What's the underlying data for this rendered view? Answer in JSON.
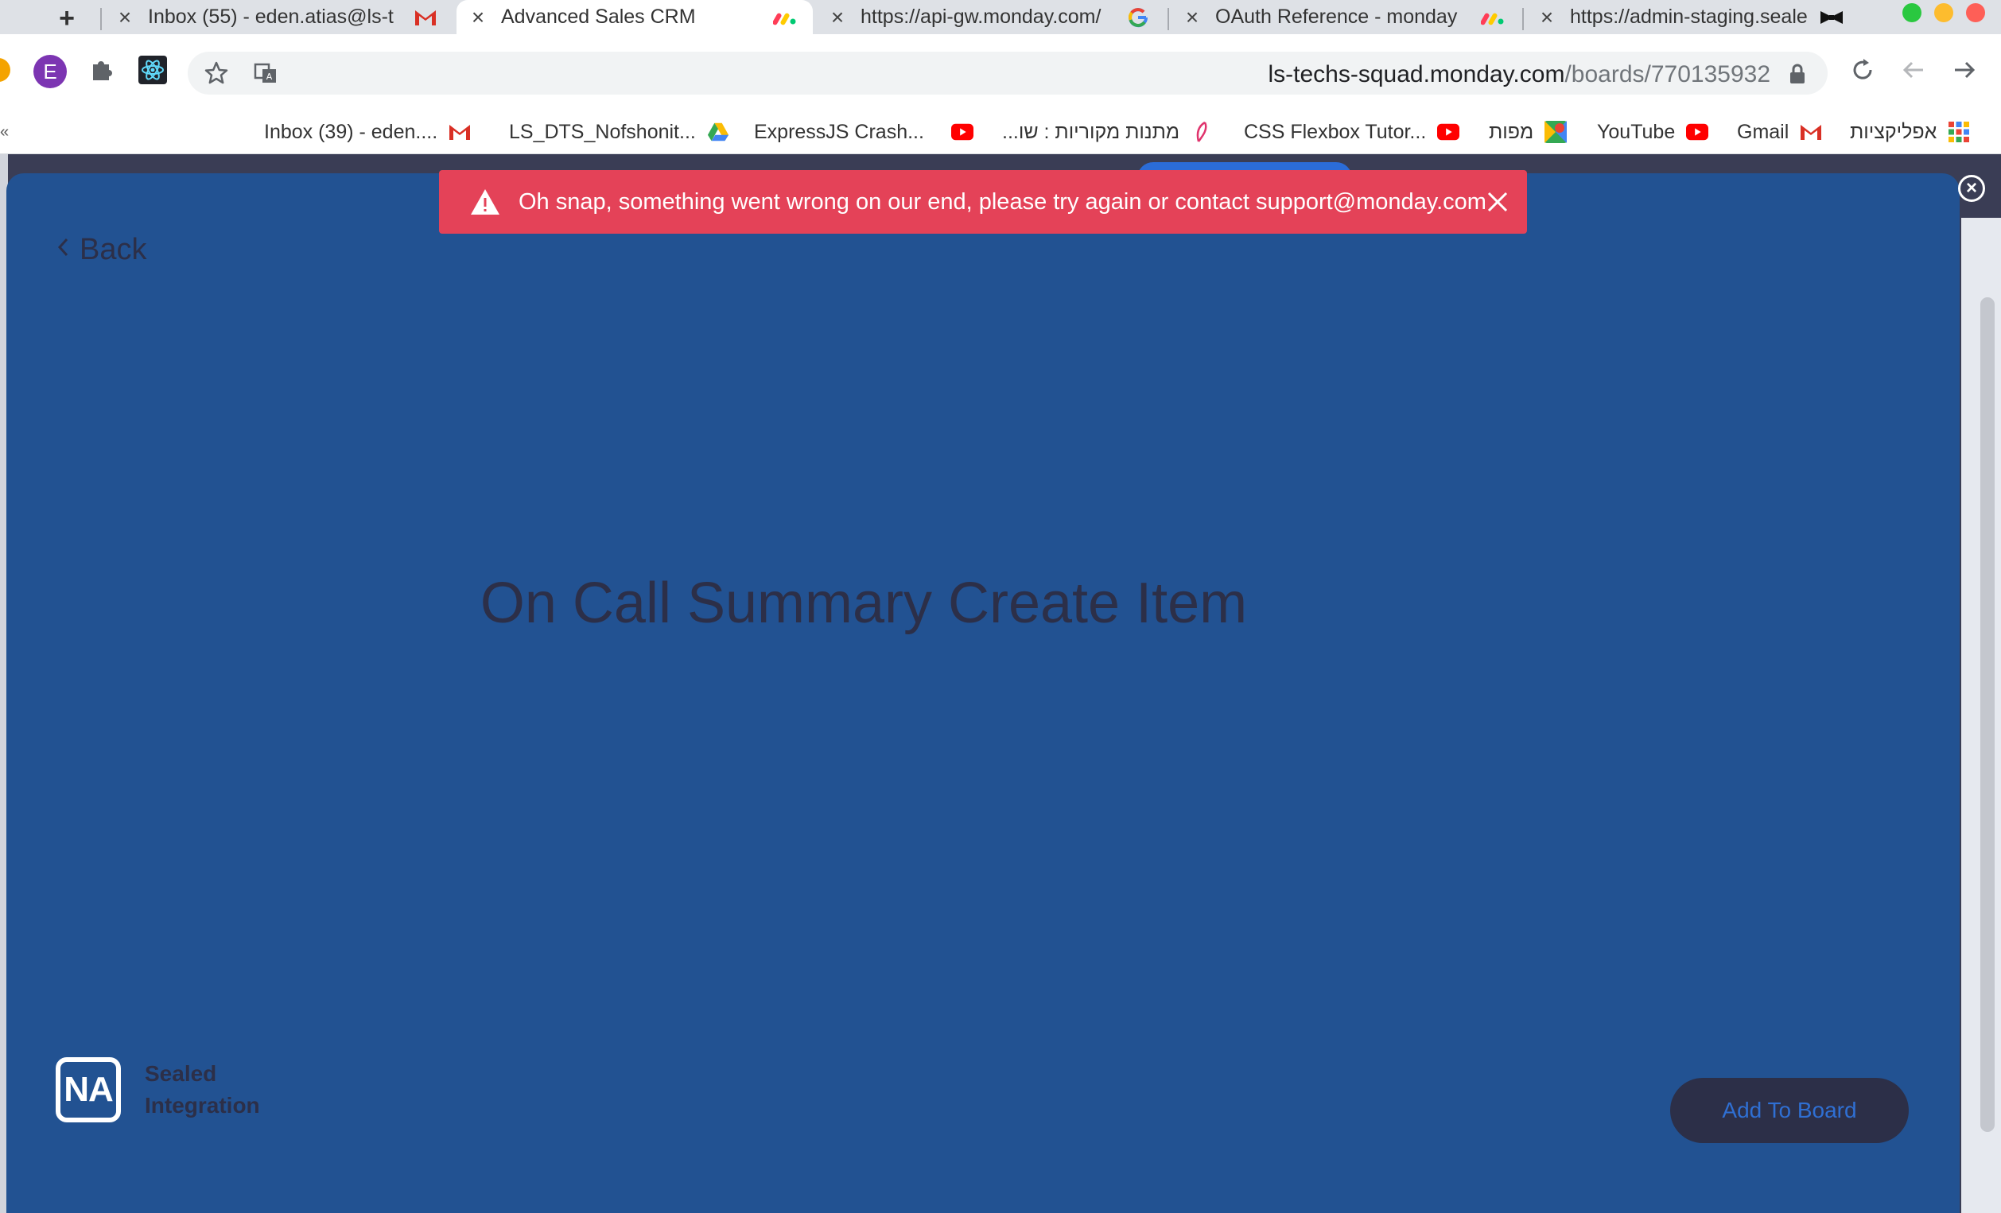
{
  "browser": {
    "new_tab_symbol": "+",
    "tabs": [
      {
        "title": "Inbox (55) - eden.atias@ls-t",
        "favicon": "gmail-icon",
        "close": "×"
      },
      {
        "title": "Advanced Sales CRM",
        "favicon": "monday-icon",
        "close": "×"
      },
      {
        "title": "https://api-gw.monday.com/",
        "favicon": "google-icon",
        "close": "×"
      },
      {
        "title": "OAuth Reference - monday",
        "favicon": "monday-icon",
        "close": "×"
      },
      {
        "title": "https://admin-staging.seale",
        "favicon": "bowtie-icon",
        "close": "×"
      }
    ],
    "avatar_letter": "E",
    "url_host": "ls-techs-squad.monday.com",
    "url_path": "/boards/770135932",
    "bookmarks": [
      {
        "label": "Inbox (39) - eden....",
        "icon": "gmail-icon"
      },
      {
        "label": "LS_DTS_Nofshonit...",
        "icon": "google-drive-icon"
      },
      {
        "label": "ExpressJS Crash...",
        "icon": "youtube-icon"
      },
      {
        "label": "מתנות מקוריות : שו...",
        "icon": "feather-icon"
      },
      {
        "label": "CSS Flexbox Tutor...",
        "icon": "youtube-icon"
      },
      {
        "label": "מפות",
        "icon": "google-maps-icon"
      },
      {
        "label": "YouTube",
        "icon": "youtube-icon"
      },
      {
        "label": "Gmail",
        "icon": "gmail-icon"
      },
      {
        "label": "אפליקציות",
        "icon": "apps-grid-icon"
      }
    ],
    "colors": {
      "tabbar": "#dee1e6",
      "gmail_red": "#d93025",
      "youtube_red": "#ff0000",
      "traffic_green": "#2ac840",
      "traffic_yellow": "#fdbc2e",
      "traffic_red": "#fe5f57"
    }
  },
  "toast": {
    "message": "Oh snap, something went wrong on our end, please try again or contact support@monday.com",
    "color": "#e44258"
  },
  "modal": {
    "back_label": "Back",
    "title": "On Call Summary Create Item",
    "brand_logo_text": "NA",
    "brand_name_line1": "Sealed",
    "brand_name_line2": "Integration",
    "add_button_label": "Add To Board",
    "close_symbol": "×",
    "background": "#225292"
  }
}
